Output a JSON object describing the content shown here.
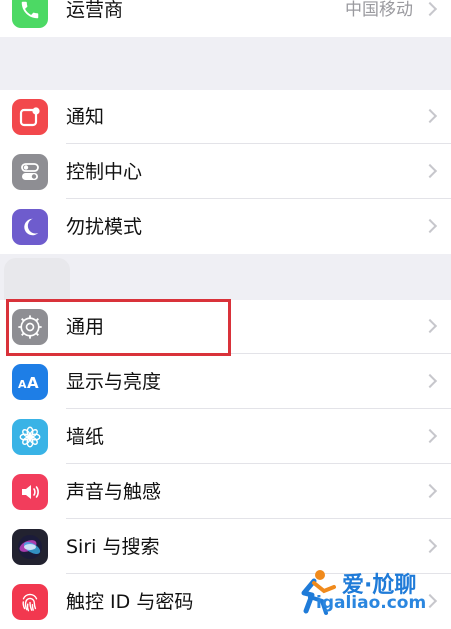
{
  "settings": {
    "carrier": {
      "label": "运营商",
      "value": "中国移动",
      "icon": "phone-icon",
      "color": "#4cd964"
    },
    "items": [
      {
        "label": "通知",
        "icon": "notifications-icon",
        "color": "#f2484c"
      },
      {
        "label": "控制中心",
        "icon": "control-center-icon",
        "color": "#8e8e93"
      },
      {
        "label": "勿扰模式",
        "icon": "moon-icon",
        "color": "#6e5ccd"
      },
      {
        "label": "通用",
        "icon": "gear-icon",
        "color": "#8e8e93",
        "highlighted": true
      },
      {
        "label": "显示与亮度",
        "icon": "display-brightness-icon",
        "color": "#1e7ee6"
      },
      {
        "label": "墙纸",
        "icon": "wallpaper-flower-icon",
        "color": "#39b3e6"
      },
      {
        "label": "声音与触感",
        "icon": "speaker-icon",
        "color": "#f23d5c"
      },
      {
        "label": "Siri 与搜索",
        "icon": "siri-icon",
        "color": "#222230"
      },
      {
        "label": "触控 ID 与密码",
        "icon": "fingerprint-icon",
        "color": "#f2384f"
      }
    ]
  },
  "watermark": {
    "title": "爱·尬聊",
    "domain": "igaliao.com",
    "icon": "running-figure-logo-icon"
  }
}
